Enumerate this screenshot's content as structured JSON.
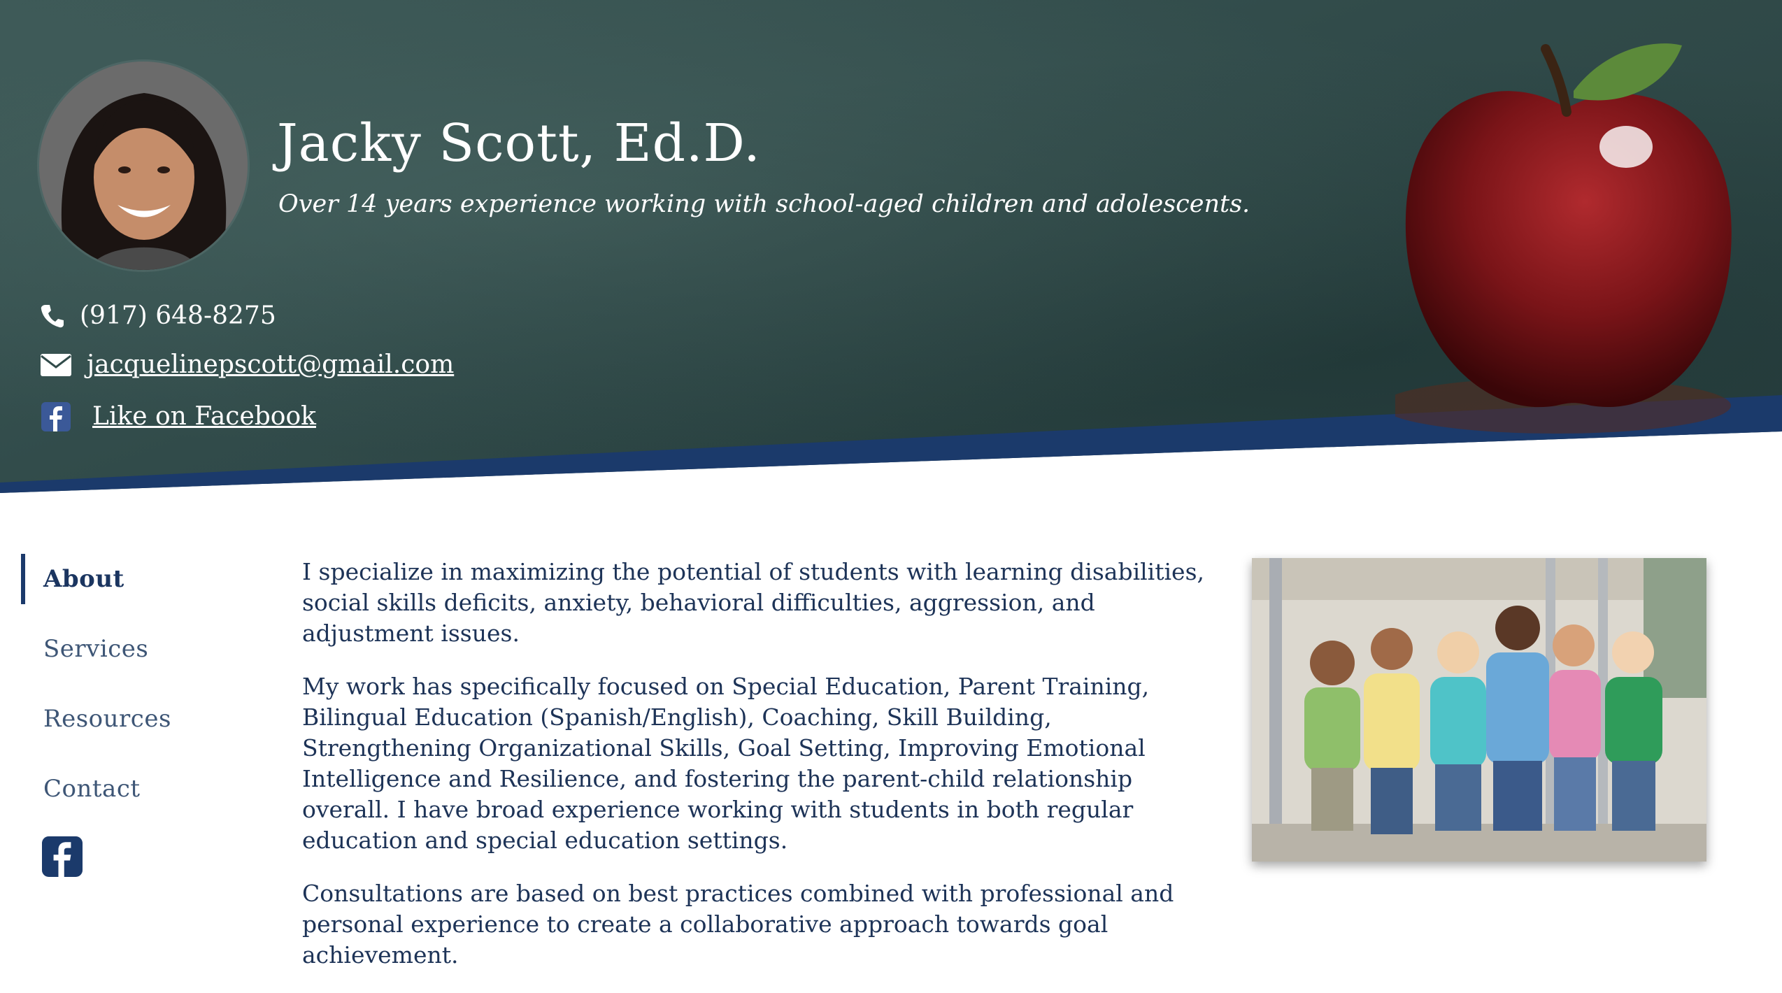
{
  "header": {
    "name": "Jacky Scott, Ed.D.",
    "tagline": "Over 14 years experience working with school-aged children and adolescents.",
    "avatar_icon": "portrait-photo",
    "phone": "(917) 648-8275",
    "email": "jacquelinepscott@gmail.com",
    "facebook_link": "Like on Facebook"
  },
  "sidebar": {
    "items": [
      {
        "label": "About",
        "active": true
      },
      {
        "label": "Services",
        "active": false
      },
      {
        "label": "Resources",
        "active": false
      },
      {
        "label": "Contact",
        "active": false
      }
    ],
    "facebook_icon": "facebook-icon"
  },
  "main": {
    "paragraphs": [
      "I specialize in maximizing the potential of students with learning disabilities, social skills deficits, anxiety, behavioral difficulties, aggression, and adjustment issues.",
      "My work has specifically focused on Special Education, Parent Training, Bilingual Education (Spanish/English), Coaching, Skill Building, Strengthening Organizational Skills, Goal Setting, Improving Emotional Intelligence and Resilience, and fostering the parent-child relationship overall. I have broad experience working with students in both regular education and special education settings.",
      "Consultations are based on best practices combined with professional and personal experience to create a collaborative approach towards goal achievement."
    ],
    "photo_icon": "students-group-photo"
  },
  "colors": {
    "chalkboard": "#314b4a",
    "accent_blue": "#1b3a6b",
    "text": "#1d3357",
    "apple_red": "#7a1418"
  }
}
